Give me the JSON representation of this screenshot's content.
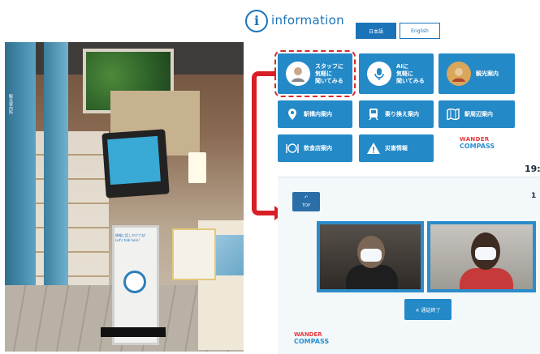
{
  "photo": {
    "sign_text": "観光案内所",
    "kiosk_text": "情報に話しかけてね! Let's talk here!"
  },
  "header": {
    "title": "information",
    "lang_ja": "日本語",
    "lang_en": "English"
  },
  "menu": {
    "staff": "スタッフに\n気軽に\n聞いてみる",
    "ai": "AIに\n気軽に\n聞いてみる",
    "sightseeing": "観光案内",
    "station": "駅構内案内",
    "transfer": "乗り換え案内",
    "nearby": "駅周辺案内",
    "restaurant": "飲食店案内",
    "disaster": "災害情報"
  },
  "brand": {
    "line1": "WANDER",
    "line2": "COMPASS"
  },
  "clock_main": "19:",
  "video_call": {
    "top_label": "TOP",
    "clock": "1",
    "end_label": "✕ 通話終了"
  },
  "colors": {
    "tile_blue": "#2389c7",
    "brand_blue": "#1b73b8",
    "highlight_red": "#d91f26"
  }
}
